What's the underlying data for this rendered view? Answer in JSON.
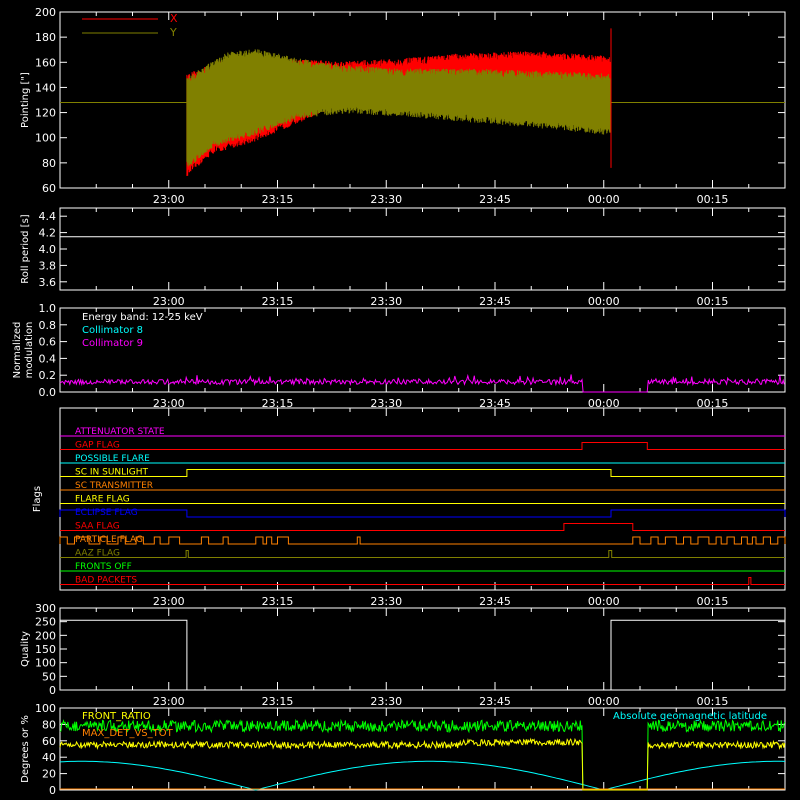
{
  "colors": {
    "axis": "#ffffff",
    "x_red": "#ff0000",
    "y_olive": "#808000",
    "green": "#00ff00",
    "yellow": "#ffff00",
    "cyan": "#00ffff",
    "magenta": "#ff00ff",
    "orange": "#ff8000",
    "blue": "#0000ff",
    "white": "#ffffff"
  },
  "time_ticks": [
    "23:00",
    "23:15",
    "23:30",
    "23:45",
    "00:00",
    "00:15"
  ],
  "chart_data": [
    {
      "type": "line",
      "ylabel": "Pointing [\"]",
      "ylim": [
        60,
        200
      ],
      "yticks": [
        60,
        80,
        100,
        120,
        140,
        160,
        180,
        200
      ],
      "legend": [
        "X",
        "Y"
      ],
      "baseline": 128,
      "data_start_min": 2.5,
      "data_end_min": 61.0,
      "series": [
        {
          "name": "X",
          "lower": [
            [
              2.5,
              72
            ],
            [
              6,
              90
            ],
            [
              12,
              100
            ],
            [
              18,
              115
            ],
            [
              24,
              130
            ],
            [
              32,
              135
            ],
            [
              42,
              140
            ],
            [
              52,
              142
            ],
            [
              61,
              140
            ]
          ],
          "upper": [
            [
              2.5,
              148
            ],
            [
              8,
              160
            ],
            [
              16,
              160
            ],
            [
              24,
              158
            ],
            [
              32,
              160
            ],
            [
              40,
              164
            ],
            [
              50,
              166
            ],
            [
              61,
              162
            ]
          ]
        },
        {
          "name": "Y",
          "lower": [
            [
              2.5,
              78
            ],
            [
              6,
              95
            ],
            [
              12,
              105
            ],
            [
              18,
              118
            ],
            [
              24,
              122
            ],
            [
              32,
              120
            ],
            [
              42,
              115
            ],
            [
              52,
              110
            ],
            [
              61,
              105
            ]
          ],
          "upper": [
            [
              2.5,
              145
            ],
            [
              8,
              165
            ],
            [
              12,
              168
            ],
            [
              18,
              160
            ],
            [
              24,
              155
            ],
            [
              32,
              152
            ],
            [
              42,
              152
            ],
            [
              52,
              150
            ],
            [
              61,
              148
            ]
          ]
        }
      ]
    },
    {
      "type": "line",
      "ylabel": "Roll period [s]",
      "ylim": [
        3.5,
        4.5
      ],
      "yticks": [
        3.6,
        3.8,
        4.0,
        4.2,
        4.4
      ],
      "series": [
        {
          "name": "",
          "x": [
            -15,
            85
          ],
          "y": [
            4.15,
            4.15
          ]
        }
      ]
    },
    {
      "type": "line",
      "ylabel": "Normalized modulation",
      "ylim": [
        0,
        1
      ],
      "yticks": [
        0.0,
        0.2,
        0.4,
        0.6,
        0.8,
        1.0
      ],
      "legend": [
        "Energy band: 12-25 keV",
        "Collimator 8",
        "Collimator 9"
      ],
      "gap": [
        57,
        66
      ],
      "mean": 0.12
    },
    {
      "type": "table",
      "ylabel": "Flags",
      "flags": [
        {
          "name": "ATTENUATOR STATE",
          "color": "magenta",
          "level": "low",
          "highs": []
        },
        {
          "name": "GAP FLAG",
          "color": "x_red",
          "level": "low",
          "highs": [
            [
              57,
              66
            ]
          ]
        },
        {
          "name": "POSSIBLE FLARE",
          "color": "cyan",
          "level": "low",
          "highs": []
        },
        {
          "name": "SC IN SUNLIGHT",
          "color": "yellow",
          "level": "low",
          "highs": [
            [
              2.5,
              61
            ]
          ]
        },
        {
          "name": "SC TRANSMITTER",
          "color": "orange",
          "level": "low",
          "highs": []
        },
        {
          "name": "FLARE FLAG",
          "color": "yellow",
          "level": "low",
          "highs": []
        },
        {
          "name": "ECLIPSE FLAG",
          "color": "blue",
          "level": "low",
          "highs": [
            [
              -15,
              2.5
            ],
            [
              61,
              85
            ]
          ]
        },
        {
          "name": "SAA FLAG",
          "color": "x_red",
          "level": "low",
          "highs": [
            [
              54.5,
              64
            ]
          ]
        },
        {
          "name": "PARTICLE FLAG",
          "color": "orange",
          "level": "low",
          "highs": [
            [
              -15,
              -14
            ],
            [
              -13,
              -11
            ],
            [
              -9.5,
              -8.5
            ],
            [
              -7,
              -6
            ],
            [
              -4.5,
              -3.5
            ],
            [
              -2,
              -1.2
            ],
            [
              0,
              1.5
            ],
            [
              4.5,
              5.5
            ],
            [
              7.5,
              8.2
            ],
            [
              12,
              13
            ],
            [
              13.5,
              14.2
            ],
            [
              15,
              16.5
            ],
            [
              26,
              26.4
            ],
            [
              64,
              65
            ],
            [
              66.5,
              67.5
            ],
            [
              68.5,
              70
            ],
            [
              71,
              72
            ],
            [
              73,
              74.5
            ],
            [
              75.5,
              76.2
            ],
            [
              77,
              78
            ],
            [
              79,
              79.8
            ],
            [
              80.5,
              81
            ],
            [
              82,
              83
            ],
            [
              84,
              85
            ]
          ]
        },
        {
          "name": "AAZ FLAG",
          "color": "y_olive",
          "level": "low",
          "highs": [
            [
              2.4,
              2.7
            ],
            [
              60.7,
              61.1
            ]
          ]
        },
        {
          "name": "FRONTS OFF",
          "color": "green",
          "level": "low",
          "highs": []
        },
        {
          "name": "BAD PACKETS",
          "color": "x_red",
          "level": "low",
          "highs": [
            [
              80,
              80.3
            ]
          ]
        }
      ]
    },
    {
      "type": "line",
      "ylabel": "Quality",
      "ylim": [
        0,
        300
      ],
      "yticks": [
        0,
        50,
        100,
        150,
        200,
        250,
        300
      ],
      "series": [
        {
          "name": "",
          "x": [
            -15,
            2.5,
            2.5,
            61,
            61,
            85
          ],
          "y": [
            255,
            255,
            0,
            0,
            255,
            255
          ]
        }
      ]
    },
    {
      "type": "line",
      "ylabel": "Degrees or %",
      "ylim": [
        0,
        100
      ],
      "yticks": [
        0,
        20,
        40,
        60,
        80,
        100
      ],
      "legend": [
        "FRONT_RATIO",
        "MAX_DET_VS_TOT",
        "Absolute geomagnetic latitude"
      ],
      "gap": [
        57,
        66
      ],
      "front_ratio_level": 78,
      "max_det_level": 55,
      "latitude_peak": 35,
      "latitude_zeros": [
        12,
        60
      ]
    }
  ]
}
